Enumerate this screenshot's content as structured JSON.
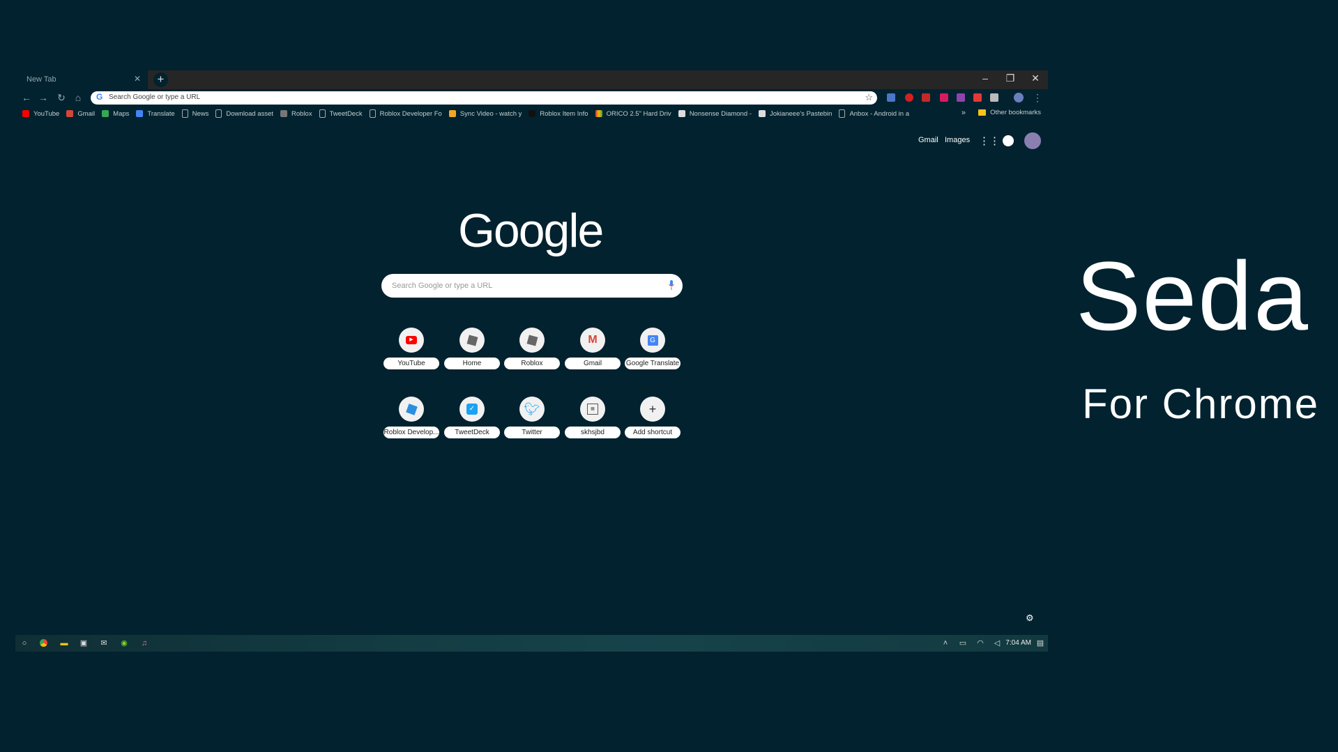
{
  "tab": {
    "title": "New Tab"
  },
  "window_controls": {
    "minimize": "–",
    "restore": "❐",
    "close": "✕"
  },
  "omnibox": {
    "placeholder": "Search Google or type a URL"
  },
  "bookmarks": [
    {
      "label": "YouTube",
      "icon": "youtube-icon",
      "color": "#ff0000"
    },
    {
      "label": "Gmail",
      "icon": "gmail-icon",
      "color": "#d44638"
    },
    {
      "label": "Maps",
      "icon": "maps-icon",
      "color": "#34a853"
    },
    {
      "label": "Translate",
      "icon": "translate-icon",
      "color": "#4285f4"
    },
    {
      "label": "News",
      "icon": "page-icon",
      "color": "#02222f"
    },
    {
      "label": "Download asset",
      "icon": "page-icon",
      "color": "#02222f"
    },
    {
      "label": "Roblox",
      "icon": "roblox-icon",
      "color": "#777777"
    },
    {
      "label": "TweetDeck",
      "icon": "page-icon",
      "color": "#02222f"
    },
    {
      "label": "Roblox Developer Fo",
      "icon": "page-icon",
      "color": "#02222f"
    },
    {
      "label": "Sync Video - watch y",
      "icon": "sync-video-icon",
      "color": "#f5a623"
    },
    {
      "label": "Roblox Item Info",
      "icon": "roblox-item-icon",
      "color": "#111111"
    },
    {
      "label": "ORICO 2.5\" Hard Driv",
      "icon": "orico-icon",
      "color": "#e8c200"
    },
    {
      "label": "Nonsense Diamond -",
      "icon": "grid-icon",
      "color": "#dddddd"
    },
    {
      "label": "Jokianeee's Pastebin",
      "icon": "grid-icon",
      "color": "#dddddd"
    },
    {
      "label": "Anbox - Android in a",
      "icon": "page-icon",
      "color": "#02222f"
    }
  ],
  "bookmarks_more": "»",
  "other_bookmarks": "Other bookmarks",
  "header_links": {
    "gmail": "Gmail",
    "images": "Images"
  },
  "search": {
    "placeholder": "Search Google or type a URL"
  },
  "logo": "Google",
  "shortcuts": [
    {
      "label": "YouTube",
      "icon": "youtube-icon",
      "color": "#ff0000"
    },
    {
      "label": "Home",
      "icon": "roblox-icon",
      "color": "#666666"
    },
    {
      "label": "Roblox",
      "icon": "roblox-icon",
      "color": "#666666"
    },
    {
      "label": "Gmail",
      "icon": "gmail-icon",
      "color": "#d44638"
    },
    {
      "label": "Google Translate",
      "icon": "translate-icon",
      "color": "#4285f4"
    },
    {
      "label": "Roblox Develop...",
      "icon": "roblox-dev-icon",
      "color": "#2b8fe0"
    },
    {
      "label": "TweetDeck",
      "icon": "tweetdeck-icon",
      "color": "#1da1f2"
    },
    {
      "label": "Twitter",
      "icon": "twitter-icon",
      "color": "#1da1f2"
    },
    {
      "label": "skhsjbd",
      "icon": "grid-icon",
      "color": "#555555"
    },
    {
      "label": "Add shortcut",
      "icon": "plus-icon",
      "color": "#333333"
    }
  ],
  "taskbar": {
    "time": "7:04 AM"
  },
  "brand": {
    "title": "Seda",
    "subtitle": "For Chrome"
  }
}
